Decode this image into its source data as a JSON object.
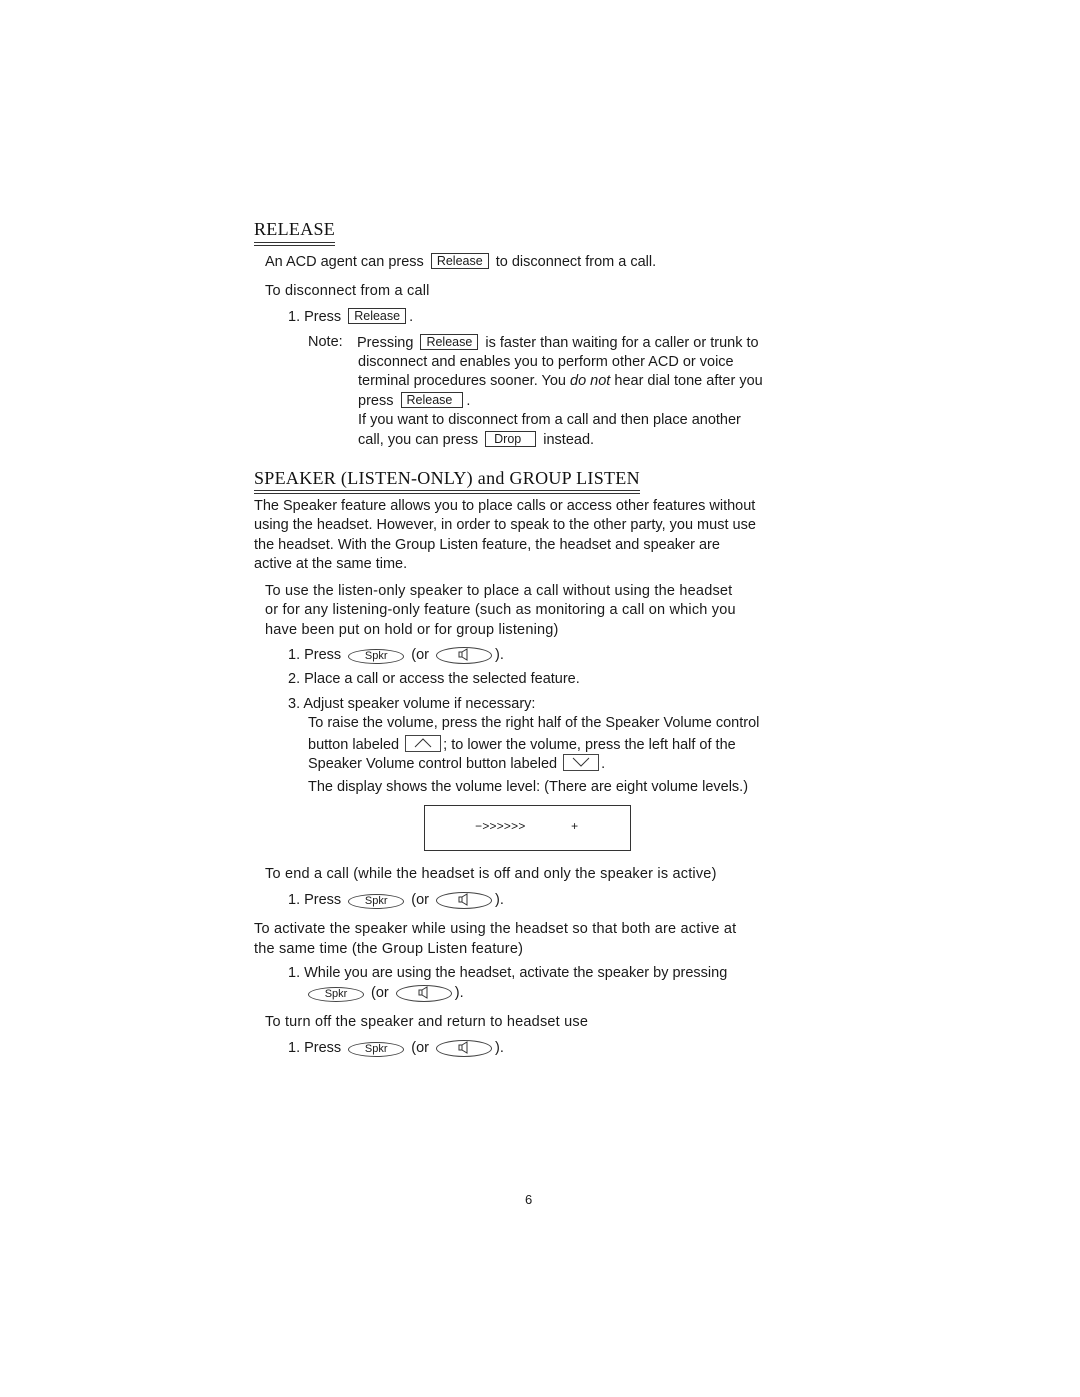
{
  "release": {
    "title": "RELEASE",
    "intro_a": "An ACD agent can press",
    "intro_key": "Release",
    "intro_b": "to disconnect from a call.",
    "procedure_title": "To disconnect from a call",
    "step1_a": "1. Press",
    "step1_key": "Release",
    "step1_b": ".",
    "note_label": "Note:",
    "note_line1_a": "Pressing",
    "note_line1_key": "Release",
    "note_line1_b": "is faster than waiting for a caller or trunk to",
    "note_line2": "disconnect and enables you to perform other ACD or voice",
    "note_line3_a": "terminal procedures sooner. You",
    "note_line3_em": "do not",
    "note_line3_b": "hear dial tone after you",
    "note_line4_a": "press",
    "note_line4_key": "Release",
    "note_line4_b": ".",
    "note_line5": "If you want to disconnect from a call and then place another",
    "note_line6_a": "call, you can press",
    "note_line6_key": "Drop",
    "note_line6_b": "instead."
  },
  "speaker": {
    "title": "SPEAKER (LISTEN-ONLY) and GROUP LISTEN",
    "para1": [
      "The Speaker feature allows you to place calls or access other features without",
      "using the headset. However, in order to speak to the other party, you must use",
      "the headset. With the Group Listen feature, the headset and speaker are",
      "active at the same time."
    ],
    "proc1_title": [
      "To use the listen-only speaker to place a call without using the headset",
      "or for any listening-only feature (such as monitoring a call on which you",
      "have been put on hold or for group listening)"
    ],
    "spkr_key": "Spkr",
    "press": "1. Press",
    "or_open": "(or",
    "or_close": ").",
    "proc1_step2": "2. Place a call or access the selected feature.",
    "proc1_step3": "3. Adjust speaker volume if necessary:",
    "step3_line1": "To raise the volume, press the right half of the Speaker Volume control",
    "step3_line2_a": "button labeled",
    "step3_line2_b": "; to lower the volume, press the left half of the",
    "step3_line3_a": "Speaker Volume control button labeled",
    "step3_line3_b": ".",
    "display_note": "The display shows the volume level: (There are eight volume levels.)",
    "display": {
      "left": "−>>>>>>",
      "right": "+",
      "level": 6,
      "max_levels": 8
    },
    "proc2_title": "To end a call (while the headset is off and only the speaker is active)",
    "proc3_title": [
      "To activate the speaker while using the headset so that both are active at",
      "the same time (the Group Listen feature)"
    ],
    "proc3_step1": "1. While you are using the headset, activate the speaker by pressing",
    "proc4_title": "To turn off the speaker and return to headset use"
  },
  "footer": {
    "page_number": "6"
  }
}
